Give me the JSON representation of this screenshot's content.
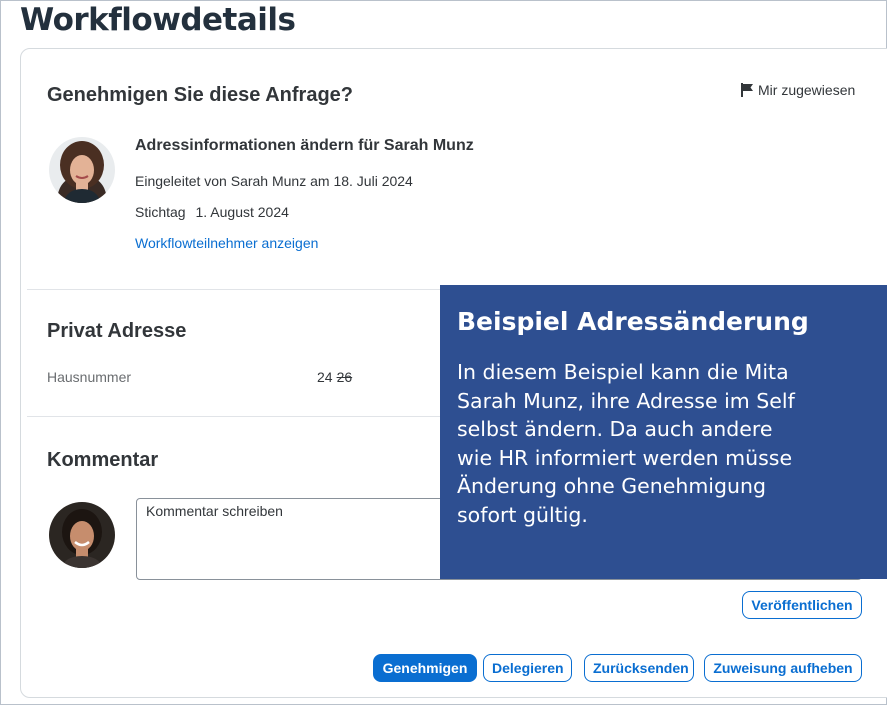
{
  "page": {
    "title": "Workflowdetails"
  },
  "approval": {
    "title": "Genehmigen Sie diese Anfrage?",
    "assigned_label": "Mir zugewiesen",
    "request_title": "Adressinformationen ändern für Sarah Munz",
    "initiated": "Eingeleitet von Sarah Munz am 18. Juli 2024",
    "due_label": "Stichtag",
    "due_date": "1. August 2024",
    "participants_link": "Workflowteilnehmer anzeigen"
  },
  "address": {
    "title": "Privat Adresse",
    "field_label": "Hausnummer",
    "new_value": "24",
    "old_value": "26"
  },
  "comment": {
    "title": "Kommentar",
    "placeholder": "Kommentar schreiben",
    "publish_label": "Veröffentlichen"
  },
  "actions": {
    "approve": "Genehmigen",
    "delegate": "Delegieren",
    "send_back": "Zurücksenden",
    "unassign": "Zuweisung aufheben"
  },
  "overlay": {
    "title": "Beispiel Adressänderung",
    "text": "In diesem Beispiel kann die Mita\nSarah Munz, ihre Adresse im Self\nselbst ändern. Da auch andere\nwie HR informiert werden müsse\nÄnderung ohne Genehmigung\nsofort gültig."
  },
  "colors": {
    "accent": "#0a6ed1",
    "overlay_bg": "#2e4f91",
    "title": "#23303d"
  },
  "icons": [
    "flag-icon"
  ]
}
